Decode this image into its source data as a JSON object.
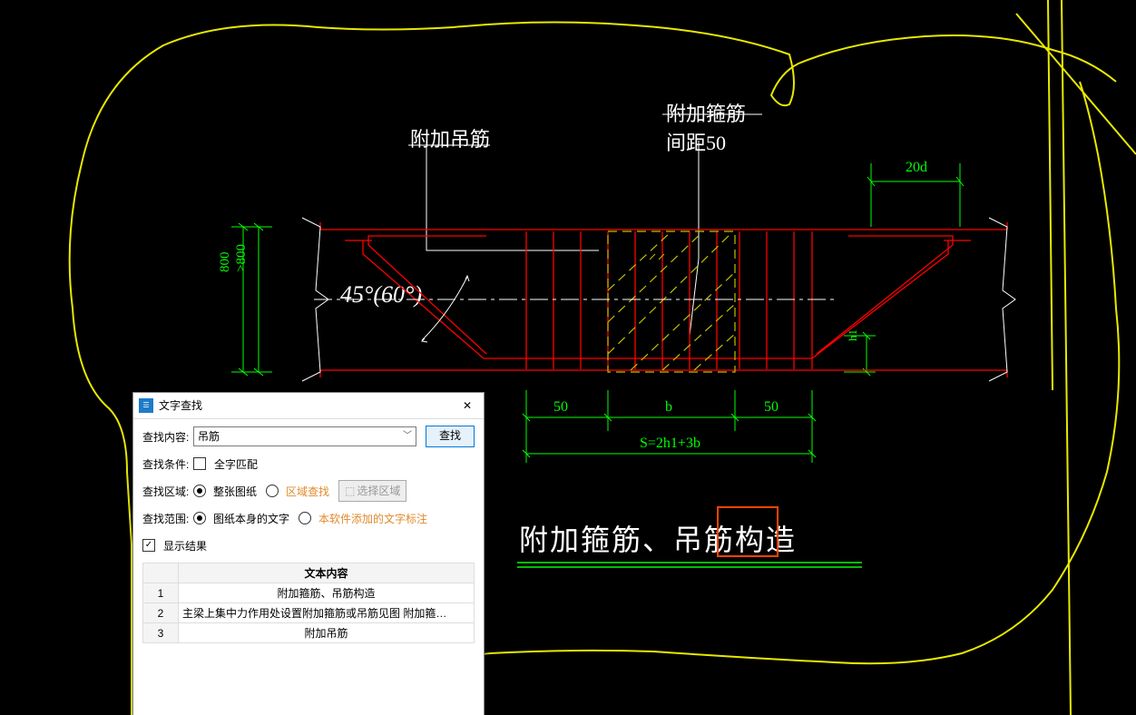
{
  "drawing": {
    "label_top_left": "附加吊筋",
    "label_top_right1": "附加箍筋",
    "label_top_right2": "间距50",
    "dim_20d": "20d",
    "dim_left_800a": "800",
    "dim_left_800b": ">800",
    "angle_text": "45°(60°)",
    "dim_bottom_50a": "50",
    "dim_bottom_b": "b",
    "dim_bottom_50b": "50",
    "dim_bottom_h1": "h1",
    "dim_formula": "S=2h1+3b",
    "title": "附加箍筋、吊筋构造"
  },
  "dialog": {
    "title": "文字查找",
    "label_search": "查找内容:",
    "search_value": "吊筋",
    "btn_search": "查找",
    "label_condition": "查找条件:",
    "cond_fullmatch": "全字匹配",
    "label_region": "查找区域:",
    "region_whole": "整张图纸",
    "region_area": "区域查找",
    "btn_select_region": "选择区域",
    "label_scope": "查找范围:",
    "scope_drawing": "图纸本身的文字",
    "scope_software": "本软件添加的文字标注",
    "show_results": "显示结果",
    "table_header": "文本内容",
    "rows": {
      "1": "附加箍筋、吊筋构造",
      "2": "主梁上集中力作用处设置附加箍筋或吊筋见图   附加箍…",
      "3": "附加吊筋"
    }
  }
}
